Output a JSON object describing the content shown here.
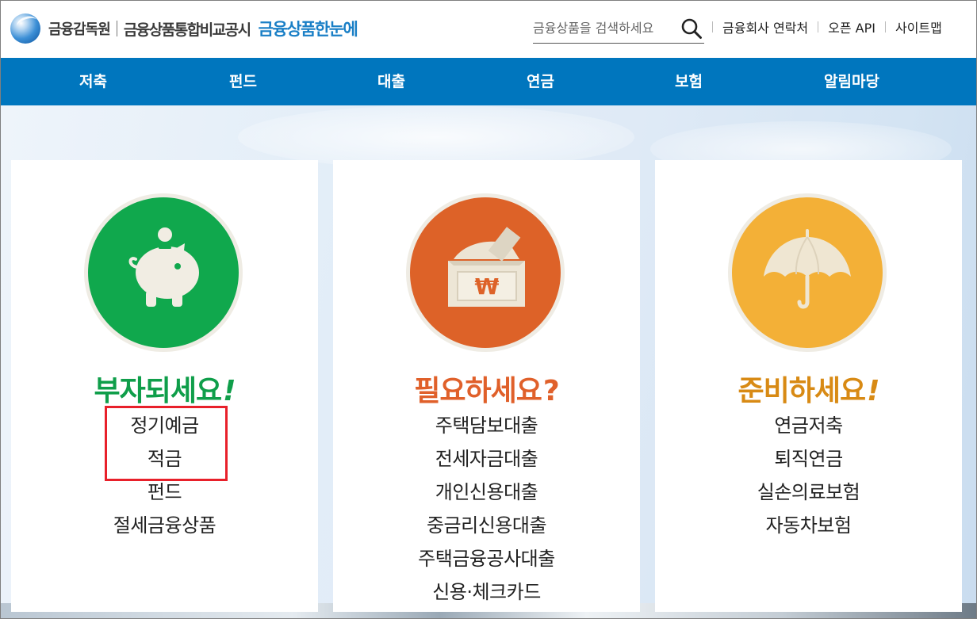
{
  "header": {
    "logo_org": "금융감독원",
    "logo_title": "금융상품통합비교공시",
    "logo_sub": "금융상품한눈에",
    "search_placeholder": "금융상품을 검색하세요",
    "util_links": [
      "금융회사 연락처",
      "오픈 API",
      "사이트맵"
    ]
  },
  "nav": {
    "items": [
      "저축",
      "펀드",
      "대출",
      "연금",
      "보험",
      "알림마당"
    ]
  },
  "cards": [
    {
      "title": "부자되세요",
      "mark": "!",
      "color": "#0f9e4a",
      "circle_color": "#10a84d",
      "icon": "piggy-bank-icon",
      "links": [
        "정기예금",
        "적금",
        "펀드",
        "절세금융상품"
      ]
    },
    {
      "title": "필요하세요",
      "mark": "?",
      "color": "#e0602a",
      "circle_color": "#dd6228",
      "icon": "money-box-icon",
      "icon_symbol": "₩",
      "links": [
        "주택담보대출",
        "전세자금대출",
        "개인신용대출",
        "중금리신용대출",
        "주택금융공사대출",
        "신용·체크카드"
      ]
    },
    {
      "title": "준비하세요",
      "mark": "!",
      "color": "#d88a14",
      "circle_color": "#f3b037",
      "icon": "umbrella-icon",
      "links": [
        "연금저축",
        "퇴직연금",
        "실손의료보험",
        "자동차보험"
      ]
    }
  ],
  "colors": {
    "nav_bg": "#0076be",
    "logo_blue": "#1a7fc6",
    "highlight": "#e8202a"
  }
}
